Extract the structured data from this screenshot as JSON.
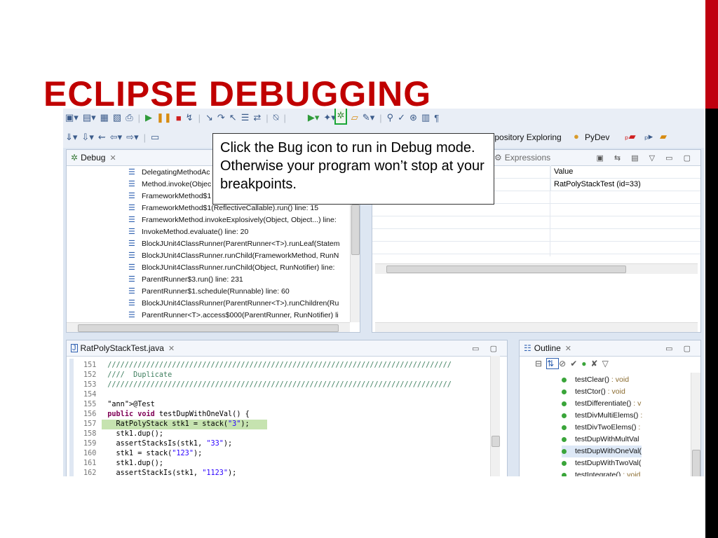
{
  "slide": {
    "title": "ECLIPSE DEBUGGING",
    "colors": {
      "accent_red": "#c0000f",
      "title_red": "#c00000",
      "bar_black": "#000000"
    }
  },
  "callout": {
    "text": "Click the Bug icon to run in Debug mode. Otherwise your program won’t stop at your breakpoints."
  },
  "toolbar": {
    "perspectives": [
      "Repository Exploring",
      "PyDev"
    ],
    "icons": [
      "new-icon",
      "save-icon",
      "print-icon",
      "resume-icon",
      "suspend-icon",
      "terminate-icon",
      "step-into-icon",
      "step-over-icon",
      "step-return-icon",
      "debug-bug-icon",
      "run-icon",
      "external-tools-icon",
      "open-folder-icon"
    ]
  },
  "debug_view": {
    "tab_label": "Debug",
    "stack": [
      "DelegatingMethodAc",
      "Method.invoke(Objec",
      "FrameworkMethod$1",
      "FrameworkMethod$1(ReflectiveCallable).run() line: 15",
      "FrameworkMethod.invokeExplosively(Object, Object...) line:",
      "InvokeMethod.evaluate() line: 20",
      "BlockJUnit4ClassRunner(ParentRunner<T>).runLeaf(Statem",
      "BlockJUnit4ClassRunner.runChild(FrameworkMethod, RunN",
      "BlockJUnit4ClassRunner.runChild(Object, RunNotifier) line:",
      "ParentRunner$3.run() line: 231",
      "ParentRunner$1.schedule(Runnable) line: 60",
      "BlockJUnit4ClassRunner(ParentRunner<T>).runChildren(Ru",
      "ParentRunner<T>.access$000(ParentRunner, RunNotifier) li"
    ]
  },
  "variables_view": {
    "tab_label": "Expressions",
    "column_value": "Value",
    "row_value": "RatPolyStackTest  (id=33)"
  },
  "editor": {
    "tab_label": "RatPolyStackTest.java",
    "lines": [
      {
        "n": "151",
        "text": "  ////////////////////////////////////////////////////////////////////////////////"
      },
      {
        "n": "152",
        "text": "  ////  Duplicate"
      },
      {
        "n": "153",
        "text": "  ////////////////////////////////////////////////////////////////////////////////"
      },
      {
        "n": "154",
        "text": ""
      },
      {
        "n": "155",
        "text": "  @Test"
      },
      {
        "n": "156",
        "text": "  public void testDupWithOneVal() {"
      },
      {
        "n": "157",
        "text": "    RatPolyStack stk1 = stack(\"3\");"
      },
      {
        "n": "158",
        "text": "    stk1.dup();"
      },
      {
        "n": "159",
        "text": "    assertStacksIs(stk1, \"33\");"
      },
      {
        "n": "160",
        "text": "    stk1 = stack(\"123\");"
      },
      {
        "n": "161",
        "text": "    stk1.dup();"
      },
      {
        "n": "162",
        "text": "    assertStackIs(stk1, \"1123\");"
      }
    ]
  },
  "outline": {
    "tab_label": "Outline",
    "items": [
      {
        "name": "testClear()",
        "type": " : void"
      },
      {
        "name": "testCtor()",
        "type": " : void"
      },
      {
        "name": "testDifferentiate()",
        "type": " : v"
      },
      {
        "name": "testDivMultiElems()",
        "type": " :"
      },
      {
        "name": "testDivTwoElems()",
        "type": " :"
      },
      {
        "name": "testDupWithMultVal",
        "type": ""
      },
      {
        "name": "testDupWithOneVal(",
        "type": ""
      },
      {
        "name": "testDupWithTwoVal(",
        "type": ""
      },
      {
        "name": "testIntegrate()",
        "type": " : void"
      }
    ]
  }
}
